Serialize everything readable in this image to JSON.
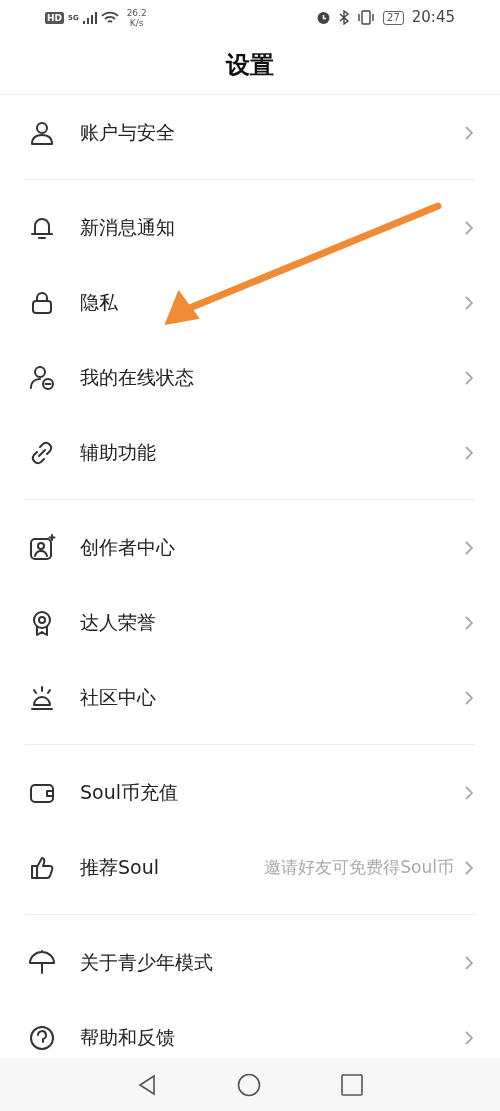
{
  "status_bar": {
    "hd": "HD",
    "network": "5G",
    "speed": "26.2",
    "speed_unit": "K/s",
    "battery": "27",
    "time": "20:45"
  },
  "header": {
    "title": "设置"
  },
  "groups": [
    {
      "items": [
        {
          "label": "账户与安全"
        }
      ]
    },
    {
      "items": [
        {
          "label": "新消息通知"
        },
        {
          "label": "隐私"
        },
        {
          "label": "我的在线状态"
        },
        {
          "label": "辅助功能"
        }
      ]
    },
    {
      "items": [
        {
          "label": "创作者中心"
        },
        {
          "label": "达人荣誉"
        },
        {
          "label": "社区中心"
        }
      ]
    },
    {
      "items": [
        {
          "label": "Soul币充值"
        },
        {
          "label": "推荐Soul",
          "hint": "邀请好友可免费得Soul币"
        }
      ]
    },
    {
      "items": [
        {
          "label": "关于青少年模式"
        },
        {
          "label": "帮助和反馈"
        }
      ]
    }
  ]
}
